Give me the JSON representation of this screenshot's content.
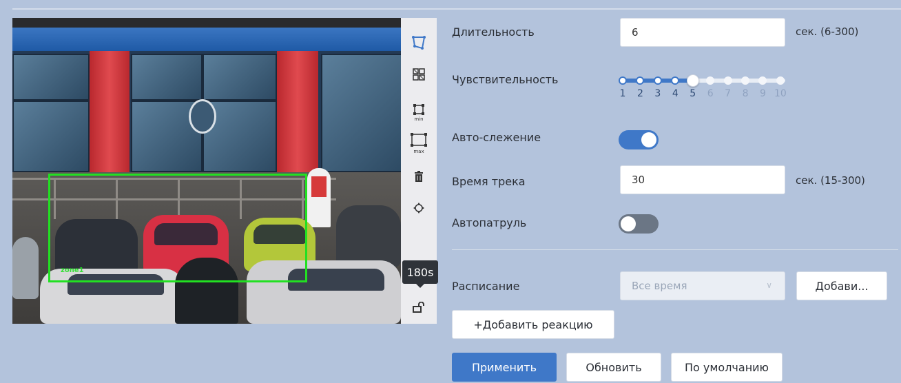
{
  "toolbar": {
    "icons": [
      "draw-zone-icon",
      "grid-zones-icon",
      "min-size-icon",
      "max-size-icon",
      "trash-icon",
      "move-icon",
      "unlock-icon"
    ],
    "min_label": "min",
    "max_label": "max",
    "tooltip": "180s"
  },
  "video": {
    "zone_label": "zone1"
  },
  "form": {
    "duration": {
      "label": "Длительность",
      "value": "6",
      "hint": "сек. (6-300)"
    },
    "sensitivity": {
      "label": "Чувствительность",
      "value": 5,
      "levels": [
        "1",
        "2",
        "3",
        "4",
        "5",
        "6",
        "7",
        "8",
        "9",
        "10"
      ]
    },
    "auto_tracking": {
      "label": "Авто-слежение",
      "enabled": true
    },
    "track_time": {
      "label": "Время трека",
      "value": "30",
      "hint": "сек. (15-300)"
    },
    "auto_patrol": {
      "label": "Автопатруль",
      "enabled": false
    },
    "schedule": {
      "label": "Расписание",
      "selected": "Все время",
      "add_button": "Добави..."
    },
    "add_reaction_button": "+Добавить реакцию",
    "apply_button": "Применить",
    "refresh_button": "Обновить",
    "default_button": "По умолчанию"
  },
  "colors": {
    "background": "#b3c3dc",
    "accent": "#3f78c8",
    "zone": "#22e022",
    "toggle_off": "#6b7685"
  }
}
